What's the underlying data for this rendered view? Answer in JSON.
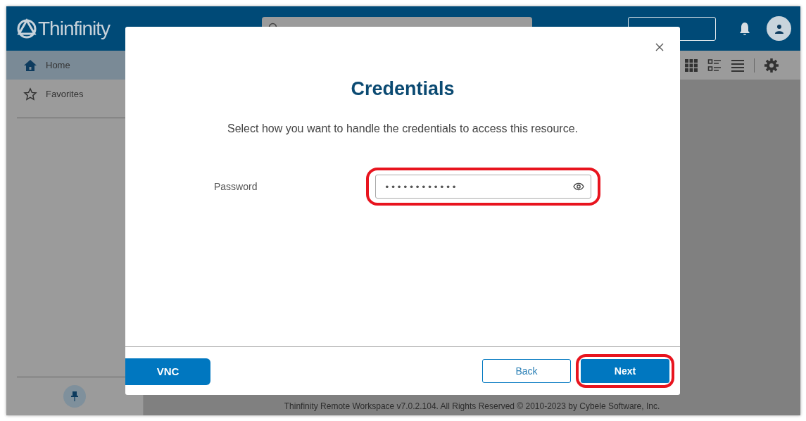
{
  "header": {
    "logo": "Thinfinity"
  },
  "sidebar": {
    "items": [
      {
        "label": "Home",
        "selected": true
      },
      {
        "label": "Favorites",
        "selected": false
      }
    ]
  },
  "footer": "Thinfinity Remote Workspace v7.0.2.104. All Rights Reserved © 2010-2023 by Cybele Software, Inc.",
  "dialog": {
    "title": "Credentials",
    "description": "Select how you want to handle the credentials to access this resource.",
    "fields": [
      {
        "label": "Password",
        "value": "••••••••••••",
        "highlighted": true
      }
    ],
    "resource_button": {
      "label": "VNC"
    },
    "buttons": [
      {
        "label": "Back",
        "kind": "secondary",
        "highlighted": false
      },
      {
        "label": "Next",
        "kind": "primary",
        "highlighted": true
      }
    ]
  }
}
